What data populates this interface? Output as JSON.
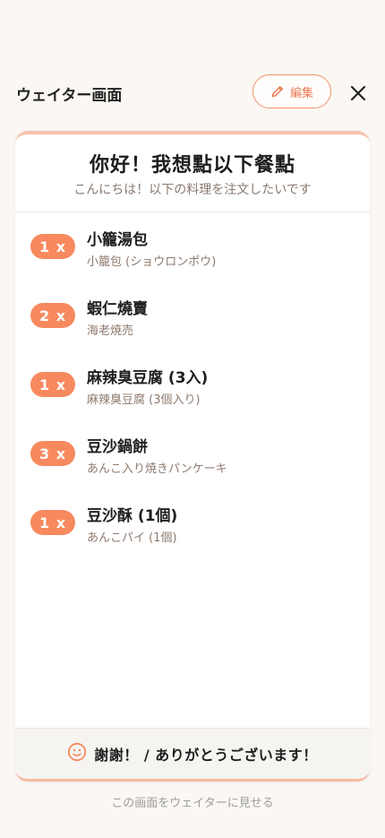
{
  "header": {
    "title": "ウェイター画面",
    "edit_label": "編集"
  },
  "card": {
    "title": "你好！我想點以下餐點",
    "subtitle": "こんにちは！以下の料理を注文したいです",
    "items": [
      {
        "qty": "1 x",
        "name": "小籠湯包",
        "sub": "小籠包 (ショウロンポウ)"
      },
      {
        "qty": "2 x",
        "name": "蝦仁燒賣",
        "sub": "海老焼売"
      },
      {
        "qty": "1 x",
        "name": "麻辣臭豆腐 (3入)",
        "sub": "麻辣臭豆腐 (3個入り)"
      },
      {
        "qty": "3 x",
        "name": "豆沙鍋餅",
        "sub": "あんこ入り焼きパンケーキ"
      },
      {
        "qty": "1 x",
        "name": "豆沙酥 (1個)",
        "sub": "あんこパイ (1個)"
      }
    ],
    "thanks": "謝謝！ / ありがとうございます！"
  },
  "footer": {
    "note": "この画面をウェイターに見せる"
  },
  "colors": {
    "accent": "#f7895f",
    "background": "#fbf8f3",
    "card": "#ffffff"
  },
  "icons": {
    "edit": "pencil-icon",
    "close": "close-icon",
    "smile": "smile-icon"
  }
}
